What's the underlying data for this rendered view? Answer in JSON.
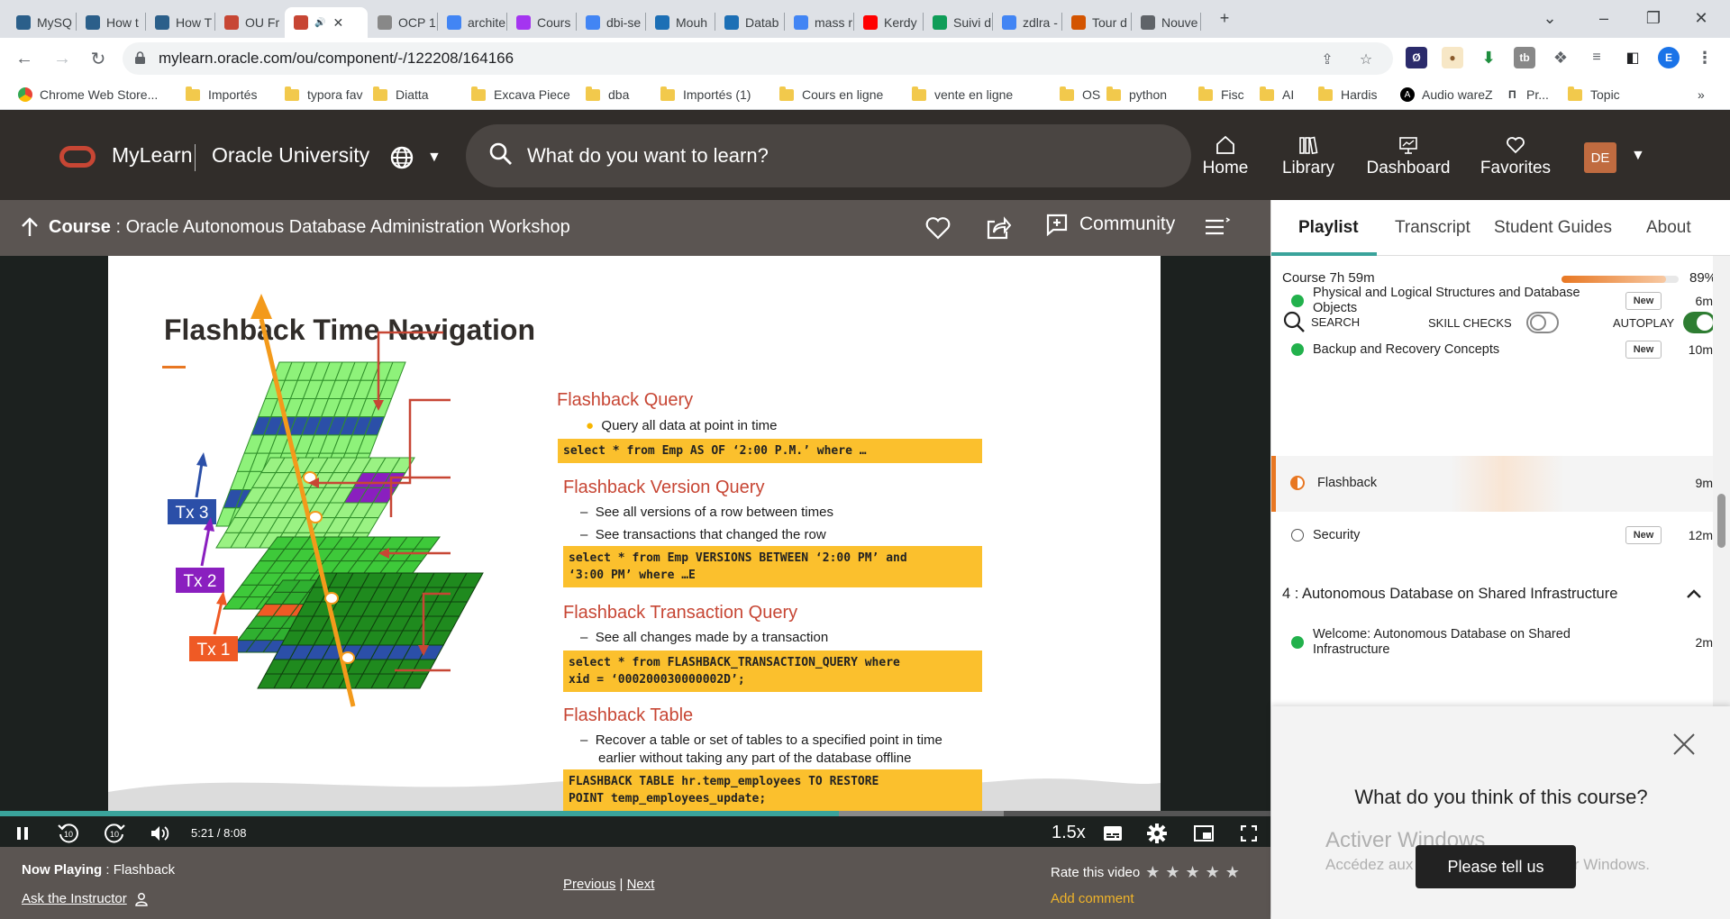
{
  "browser": {
    "tabs": [
      {
        "label": "MySQ",
        "icon": "site-icon",
        "color": "#2b5f8a"
      },
      {
        "label": "How t",
        "icon": "site-icon",
        "color": "#2b5f8a"
      },
      {
        "label": "How T",
        "icon": "site-icon",
        "color": "#2b5f8a"
      },
      {
        "label": "OU Fr",
        "icon": "oracle-icon",
        "color": "#c74634"
      },
      {
        "label": "",
        "icon": "oracle-icon",
        "color": "#c74634",
        "active": true
      },
      {
        "label": "OCP 1",
        "icon": "doc-icon",
        "color": "#888888"
      },
      {
        "label": "archite",
        "icon": "google-icon",
        "color": "#4285f4"
      },
      {
        "label": "Cours",
        "icon": "udemy-icon",
        "color": "#a435f0"
      },
      {
        "label": "dbi-se",
        "icon": "google-icon",
        "color": "#4285f4"
      },
      {
        "label": "Mouh",
        "icon": "dbi-icon",
        "color": "#1c6fb5"
      },
      {
        "label": "Datab",
        "icon": "dbi-icon",
        "color": "#1c6fb5"
      },
      {
        "label": "mass r",
        "icon": "google-icon",
        "color": "#4285f4"
      },
      {
        "label": "Kerdy",
        "icon": "youtube-icon",
        "color": "#ff0000"
      },
      {
        "label": "Suivi d",
        "icon": "sheets-icon",
        "color": "#0f9d58"
      },
      {
        "label": "zdlra -",
        "icon": "google-icon",
        "color": "#4285f4"
      },
      {
        "label": "Tour d",
        "icon": "site-icon",
        "color": "#d35400"
      },
      {
        "label": "Nouve",
        "icon": "chrome-icon",
        "color": "#5f6368"
      }
    ],
    "url": "mylearn.oracle.com/ou/component/-/122208/164166",
    "profile_initial": "E",
    "bookmarks": [
      "Chrome Web Store...",
      "Importés",
      "typora fav",
      "Diatta",
      "Excava Piece",
      "dba",
      "Importés (1)",
      "Cours en ligne",
      "vente en ligne",
      "OS",
      "python",
      "Fisc",
      "AI",
      "Hardis",
      "Audio wareZ",
      "Pr...",
      "Topic"
    ]
  },
  "header": {
    "brand": "MyLearn",
    "brand_sub": "Oracle University",
    "search_placeholder": "What do you want to learn?",
    "nav": [
      {
        "label": "Home",
        "icon": "home-icon"
      },
      {
        "label": "Library",
        "icon": "library-icon"
      },
      {
        "label": "Dashboard",
        "icon": "dashboard-icon"
      },
      {
        "label": "Favorites",
        "icon": "heart-icon"
      }
    ],
    "avatar": "DE"
  },
  "course": {
    "label": "Course",
    "separator": " : ",
    "title": "Oracle Autonomous Database Administration Workshop",
    "community": "Community"
  },
  "slide": {
    "title": "Flashback Time Navigation",
    "tx_labels": [
      "Tx 3",
      "Tx 2",
      "Tx 1"
    ],
    "sections": [
      {
        "head": "Flashback Query",
        "lines": [
          "Query all data at point in time"
        ],
        "code": "select * from Emp AS OF ‘2:00 P.M.’ where …"
      },
      {
        "head": "Flashback Version Query",
        "lines": [
          "See all versions of a row between times",
          "See transactions that changed the row"
        ],
        "code": "select * from Emp VERSIONS BETWEEN ‘2:00 PM’ and\n‘3:00 PM’ where …E"
      },
      {
        "head": "Flashback Transaction Query",
        "lines": [
          "See all changes made by a transaction"
        ],
        "code": "select * from FLASHBACK_TRANSACTION_QUERY where\nxid = ‘000200030000002D’;"
      },
      {
        "head": "Flashback Table",
        "lines": [
          "Recover a table or set of tables to a specified point in time",
          "earlier without taking any part of the database offline"
        ],
        "code": "FLASHBACK TABLE hr.temp_employees TO RESTORE\nPOINT temp_employees_update;"
      }
    ]
  },
  "player": {
    "current_time": "5:21",
    "time_sep": " / ",
    "duration": "8:08",
    "progress": 0.66,
    "buffered": 0.79,
    "speed": "1.5x",
    "skip_back": "10",
    "skip_fwd": "10"
  },
  "info": {
    "now_playing_label": "Now Playing",
    "now_playing_sep": " : ",
    "now_playing": "Flashback",
    "ask": "Ask the Instructor",
    "previous": "Previous",
    "sep": " | ",
    "next": "Next",
    "rate": "Rate this video",
    "stars": 5,
    "add_comment": "Add comment"
  },
  "panel": {
    "tabs": [
      "Playlist",
      "Transcript",
      "Student Guides",
      "About"
    ],
    "course_label": "Course",
    "course_length": "7h 59m",
    "course_progress": 0.89,
    "course_percent": "89%",
    "search": "SEARCH",
    "skill_checks": "SKILL CHECKS",
    "skill_checks_on": false,
    "autoplay": "AUTOPLAY",
    "autoplay_on": true,
    "lessons": [
      {
        "title": "Physical and Logical Structures and Database Objects",
        "badge": "New",
        "duration": "6m",
        "status": "complete"
      },
      {
        "title": "Backup and Recovery Concepts",
        "badge": "New",
        "duration": "10m",
        "status": "complete"
      },
      {
        "title": "Flashback",
        "badge": "",
        "duration": "9m",
        "status": "in-progress"
      },
      {
        "title": "Security",
        "badge": "New",
        "duration": "12m",
        "status": "not-started"
      }
    ],
    "section": "4 :  Autonomous Database on Shared Infrastructure",
    "section_lessons": [
      {
        "title": "Welcome: Autonomous Database on Shared Infrastructure",
        "duration": "2m",
        "status": "complete"
      }
    ],
    "feedback_question": "What do you think of this course?",
    "feedback_button": "Please tell us"
  },
  "os_watermark": {
    "title": "Activer Windows",
    "subtitle": "Accédez aux paramètres pour activer Windows."
  },
  "colors": {
    "oracle_red": "#c74634",
    "header_bg": "#312d2a",
    "teal": "#3aa39b",
    "orange": "#e87722",
    "complete": "#22b14c"
  }
}
